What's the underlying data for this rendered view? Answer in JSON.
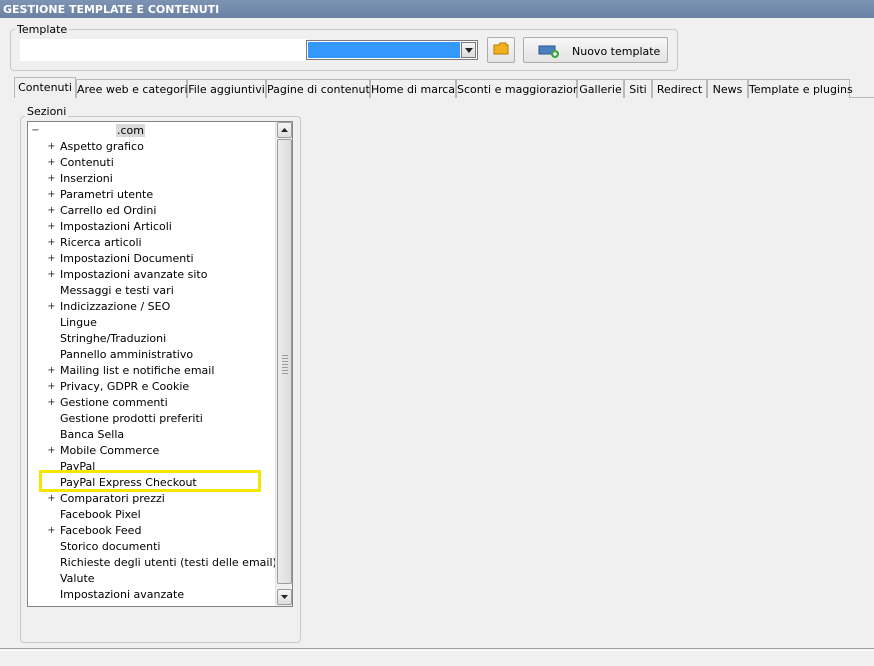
{
  "window": {
    "title": "GESTIONE TEMPLATE E CONTENUTI"
  },
  "template": {
    "group_label": "Template",
    "input_value": "",
    "select_value": "",
    "new_button_label": "Nuovo template"
  },
  "tabs": [
    {
      "label": "Contenuti",
      "active": true
    },
    {
      "label": "Aree web e categorie"
    },
    {
      "label": "File aggiuntivi"
    },
    {
      "label": "Pagine di contenuti"
    },
    {
      "label": "Home di marca"
    },
    {
      "label": "Sconti e maggiorazioni"
    },
    {
      "label": "Gallerie"
    },
    {
      "label": "Siti"
    },
    {
      "label": "Redirect"
    },
    {
      "label": "News"
    },
    {
      "label": "Template e plugins"
    }
  ],
  "sections": {
    "group_label": "Sezioni",
    "root": ".com",
    "items": [
      {
        "label": "Aspetto grafico",
        "expandable": true
      },
      {
        "label": "Contenuti",
        "expandable": true
      },
      {
        "label": "Inserzioni",
        "expandable": true
      },
      {
        "label": "Parametri utente",
        "expandable": true
      },
      {
        "label": "Carrello ed Ordini",
        "expandable": true
      },
      {
        "label": "Impostazioni Articoli",
        "expandable": true
      },
      {
        "label": "Ricerca articoli",
        "expandable": true
      },
      {
        "label": "Impostazioni Documenti",
        "expandable": true
      },
      {
        "label": "Impostazioni avanzate sito",
        "expandable": true
      },
      {
        "label": "Messaggi e testi vari",
        "expandable": false
      },
      {
        "label": "Indicizzazione / SEO",
        "expandable": true
      },
      {
        "label": "Lingue",
        "expandable": false
      },
      {
        "label": "Stringhe/Traduzioni",
        "expandable": false
      },
      {
        "label": "Pannello amministrativo",
        "expandable": false
      },
      {
        "label": "Mailing list e notifiche email",
        "expandable": true
      },
      {
        "label": "Privacy, GDPR e Cookie",
        "expandable": true
      },
      {
        "label": "Gestione commenti",
        "expandable": true
      },
      {
        "label": "Gestione prodotti preferiti",
        "expandable": false
      },
      {
        "label": "Banca Sella",
        "expandable": false
      },
      {
        "label": "Mobile Commerce",
        "expandable": true
      },
      {
        "label": "PayPal",
        "expandable": false
      },
      {
        "label": "PayPal Express Checkout",
        "expandable": false,
        "highlighted": true
      },
      {
        "label": "Comparatori prezzi",
        "expandable": true
      },
      {
        "label": "Facebook Pixel",
        "expandable": false
      },
      {
        "label": "Facebook Feed",
        "expandable": true
      },
      {
        "label": "Storico documenti",
        "expandable": false
      },
      {
        "label": "Richieste degli utenti (testi delle email)",
        "expandable": false
      },
      {
        "label": "Valute",
        "expandable": false
      },
      {
        "label": "Impostazioni avanzate",
        "expandable": false
      }
    ]
  },
  "colors": {
    "highlight": "#f5e600",
    "selection": "#3399ff",
    "titlebar": "#7088ab"
  }
}
